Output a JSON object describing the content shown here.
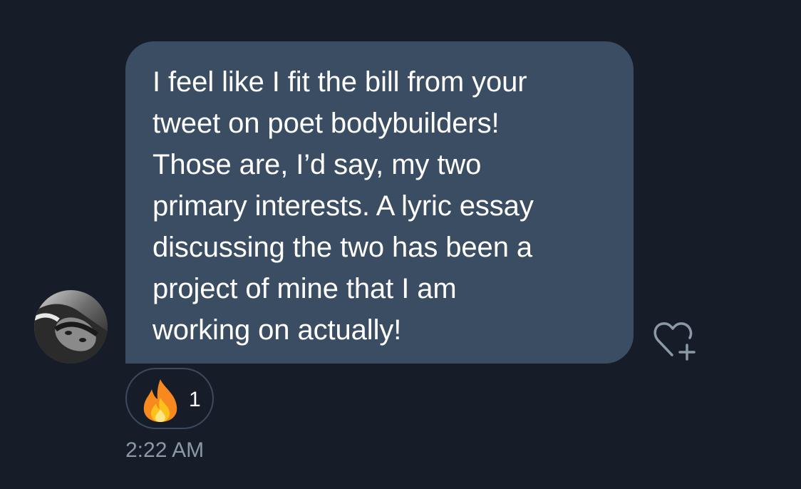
{
  "message": {
    "lines": [
      "I feel like I fit the bill from your",
      "tweet on poet bodybuilders!",
      "Those are, I’d say, my two",
      "primary interests. A lyric essay",
      "discussing the two has been a",
      "project of mine that I am",
      "working on actually!"
    ],
    "timestamp": "2:22 AM"
  },
  "reaction": {
    "icon": "fire-emoji-icon",
    "count": "1"
  },
  "actions": {
    "add_reaction_icon": "heart-plus-icon"
  },
  "colors": {
    "background": "#161d29",
    "bubble": "#3a4d62",
    "text": "#ffffff",
    "muted": "#8b98a5"
  }
}
